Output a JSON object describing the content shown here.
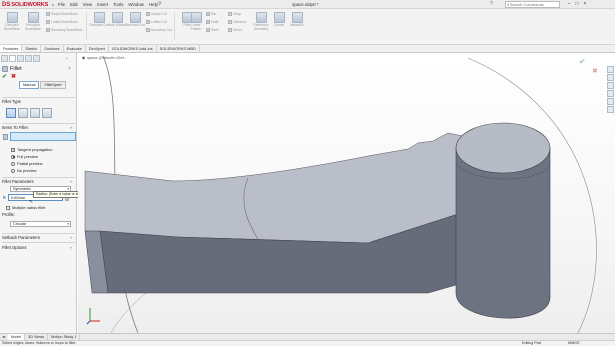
{
  "app": {
    "brand_ds": "DS",
    "brand_name": "SOLIDWORKS",
    "document_title": "space.sldprt *",
    "menu": [
      "File",
      "Edit",
      "View",
      "Insert",
      "Tools",
      "Window",
      "Help"
    ]
  },
  "search": {
    "placeholder": "Search Commands"
  },
  "ribbon": {
    "big_buttons": [
      "Extruded Boss/Base",
      "Revolved Boss/Base",
      "Extruded Cut",
      "Hole Wizard",
      "Revolved Cut",
      "Fillet",
      "Linear Pattern",
      "Reference Geometry",
      "Curves",
      "Instant3D"
    ],
    "small_buttons": [
      "Swept Boss/Base",
      "Lofted Boss/Base",
      "Boundary Boss/Base",
      "Swept Cut",
      "Lofted Cut",
      "Boundary Cut",
      "Rib",
      "Draft",
      "Shell",
      "Wrap",
      "Intersect",
      "Mirror"
    ]
  },
  "command_tabs": [
    "Features",
    "Sketch",
    "Surfaces",
    "Evaluate",
    "DimXpert",
    "SOLIDWORKS Add-Ins",
    "SOLIDWORKS MBD"
  ],
  "property_manager": {
    "title": "Fillet",
    "modes": [
      "Manual",
      "FilletXpert"
    ],
    "sections": {
      "fillet_type": "Fillet Type",
      "items_to_fillet": "Items To Fillet",
      "fillet_parameters": "Fillet Parameters",
      "profile": "Profile:",
      "setback": "Setback Parameters",
      "options": "Fillet Options"
    },
    "tangent_propagation": "Tangent propagation",
    "preview_options": [
      "Full preview",
      "Partial preview",
      "No preview"
    ],
    "parameter_type": "Symmetric",
    "radius_value": "0.00mm",
    "multiple_radius": "Multiple radius fillet",
    "profile_value": "Circular",
    "radius_tooltip": "Radius: (Enter a value or start with = to create an equation)"
  },
  "viewport": {
    "tree_label": "space  (Default<<Def..."
  },
  "bottom_tabs": [
    "Model",
    "3D Views",
    "Motion Study 1"
  ],
  "status": {
    "message": "Select edges, faces, features or loops to fillet.",
    "mode": "Editing Part",
    "units": "MMGS"
  },
  "colors": {
    "accent": "#c8102e",
    "selection": "#d6ebfa",
    "part_side": "#656a78",
    "part_top": "#b9bdc9"
  },
  "icons": [
    "search-icon",
    "fillet-icon",
    "ok-check-icon",
    "cancel-x-icon",
    "help-icon",
    "triad-icon"
  ]
}
